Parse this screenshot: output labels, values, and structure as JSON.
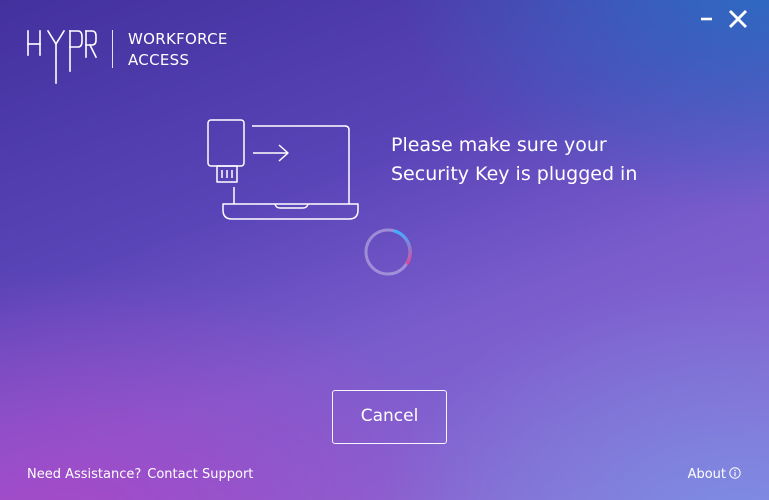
{
  "brand": {
    "logo_icon": "hypr-logo",
    "product_line1": "WORKFORCE",
    "product_line2": "ACCESS"
  },
  "window_controls": {
    "minimize_icon": "minimize-icon",
    "close_icon": "close-icon"
  },
  "main": {
    "illustration_icon": "security-key-laptop-illustration",
    "message_line1": "Please make sure your",
    "message_line2": "Security Key is plugged in",
    "spinner_icon": "loading-spinner-icon",
    "cancel_label": "Cancel"
  },
  "footer": {
    "assistance_label": "Need Assistance?",
    "contact_label": "Contact Support",
    "about_label": "About",
    "about_icon": "info-icon"
  },
  "colors": {
    "background_top_left": "#43319e",
    "background_bottom_left": "#a848c8",
    "background_top_right": "#286ec3",
    "background_bottom_right": "#7896e6",
    "foreground": "#ffffff",
    "spinner_accent_pink": "#e0479a",
    "spinner_accent_blue": "#3fb0ff"
  }
}
